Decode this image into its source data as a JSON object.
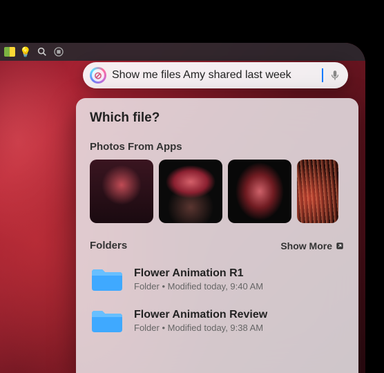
{
  "siri": {
    "query": "Show me files Amy shared last week"
  },
  "panel": {
    "title": "Which file?"
  },
  "photos_section": {
    "header": "Photos From Apps"
  },
  "folders_section": {
    "header": "Folders",
    "show_more_label": "Show More",
    "items": [
      {
        "name": "Flower Animation R1",
        "meta": "Folder • Modified today, 9:40 AM"
      },
      {
        "name": "Flower Animation Review",
        "meta": "Folder • Modified today, 9:38 AM"
      }
    ]
  },
  "colors": {
    "folder": "#3fa9ff",
    "accent": "#007aff"
  }
}
